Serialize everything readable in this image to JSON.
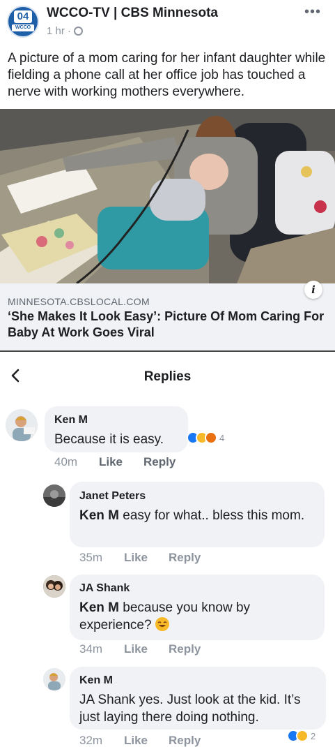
{
  "post": {
    "page_name": "WCCO-TV | CBS Minnesota",
    "logo_number": "04",
    "logo_word": "WCCO",
    "time": "1 hr",
    "separator": "·",
    "more": "•••",
    "text": "A picture of a mom caring for her infant daughter while fielding a phone call at her office job has touched a nerve with working mothers everywhere."
  },
  "link": {
    "domain": "MINNESOTA.CBSLOCAL.COM",
    "title": "‘She Makes It Look Easy’: Picture Of Mom Caring For Baby At Work Goes Viral",
    "info": "i"
  },
  "replies_header": {
    "title": "Replies"
  },
  "comments": [
    {
      "author": "Ken M",
      "text": "Because it is easy.",
      "time": "40m",
      "like": "Like",
      "reply": "Reply",
      "reactions": [
        "like",
        "haha",
        "angry"
      ],
      "reaction_count": "4"
    },
    {
      "author": "Janet Peters",
      "mention": "Ken M",
      "text": " easy for what.. bless this mom.",
      "time": "35m",
      "like": "Like",
      "reply": "Reply"
    },
    {
      "author": "JA Shank",
      "mention": "Ken M",
      "text": " because you know by experience?",
      "emoji": "laughing-emoji",
      "time": "34m",
      "like": "Like",
      "reply": "Reply"
    },
    {
      "author": "Ken M",
      "text": "JA Shank yes. Just look at the kid. It’s just laying there doing nothing.",
      "time": "32m",
      "like": "Like",
      "reply": "Reply",
      "reactions": [
        "like",
        "wow"
      ],
      "reaction_count": "2"
    }
  ],
  "colors": {
    "brand_blue": "#1877f2",
    "bubble_bg": "#f0f2f5",
    "meta_gray": "#8d949e"
  }
}
